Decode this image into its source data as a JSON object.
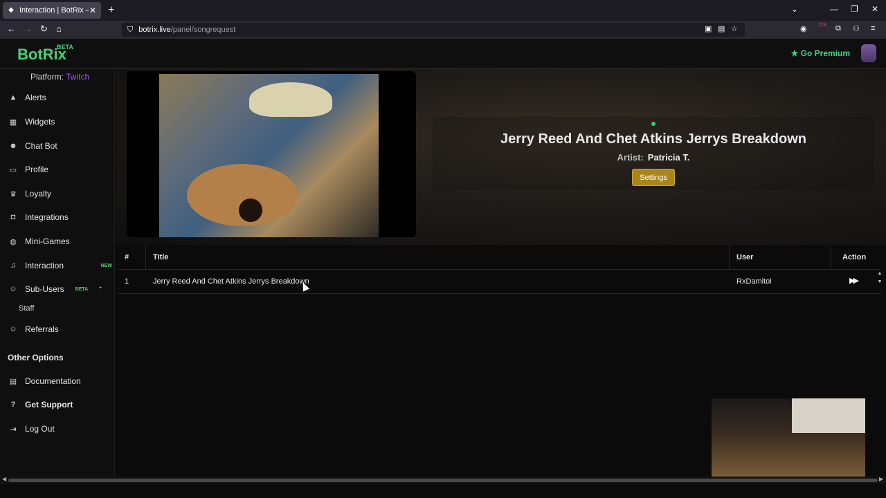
{
  "browser": {
    "tab_title": "Interaction | BotRix — Clou",
    "tab_close": "✕",
    "new_tab": "+",
    "url_host": "botrix.live",
    "url_path": "/panel/songrequest",
    "ext_count": "723"
  },
  "header": {
    "logo": "BotRix",
    "logo_badge": "BETA",
    "premium_label": "Go Premium"
  },
  "sidebar": {
    "platform_label": "Platform:",
    "platform_value": "Twitch",
    "items": [
      {
        "label": "Alerts",
        "icon": "warning-icon"
      },
      {
        "label": "Widgets",
        "icon": "widgets-icon"
      },
      {
        "label": "Chat Bot",
        "icon": "robot-icon"
      },
      {
        "label": "Profile",
        "icon": "id-card-icon"
      },
      {
        "label": "Loyalty",
        "icon": "trophy-icon"
      },
      {
        "label": "Integrations",
        "icon": "plug-icon"
      },
      {
        "label": "Mini-Games",
        "icon": "gamepad-icon"
      },
      {
        "label": "Interaction",
        "icon": "music-icon",
        "badge": "NEW"
      },
      {
        "label": "Sub-Users",
        "icon": "users-icon",
        "badge": "BETA"
      }
    ],
    "sub_items": [
      "Staff"
    ],
    "referrals": "Referrals",
    "other_options_title": "Other Options",
    "other_items": [
      {
        "label": "Documentation",
        "icon": "book-icon"
      },
      {
        "label": "Get Support",
        "icon": "question-icon"
      },
      {
        "label": "Log Out",
        "icon": "logout-icon"
      }
    ]
  },
  "now_playing": {
    "title": "Jerry Reed And Chet Atkins Jerrys Breakdown",
    "artist_label": "Artist:",
    "artist": "Patricia T.",
    "settings_label": "Settings"
  },
  "queue": {
    "headers": [
      "#",
      "Title",
      "User",
      "Action"
    ],
    "rows": [
      {
        "num": "1",
        "title": "Jerry Reed And Chet Atkins Jerrys Breakdown",
        "user": "RxDamitol"
      }
    ]
  },
  "colors": {
    "brand_green": "#46d37a",
    "twitch_purple": "#9c5bf5",
    "settings_gold": "#a8861a"
  }
}
